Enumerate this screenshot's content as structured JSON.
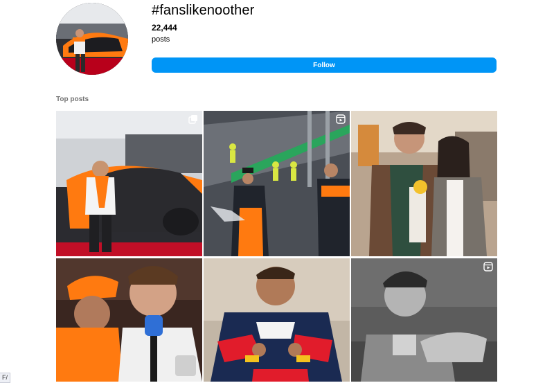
{
  "header": {
    "hashtag": "#fanslikenoother",
    "post_count": "22,444",
    "post_label": "posts",
    "follow_label": "Follow"
  },
  "top_posts": {
    "heading": "Top posts",
    "items": [
      {
        "icon": "carousel-icon"
      },
      {
        "icon": "reel-icon"
      },
      {
        "icon": null
      },
      {
        "icon": null
      },
      {
        "icon": null
      },
      {
        "icon": "reel-icon"
      }
    ]
  },
  "footer": {
    "corner_tag": "F/"
  },
  "colors": {
    "accent": "#0095f6",
    "secondary_text": "#737373",
    "papaya": "#ff8000"
  }
}
